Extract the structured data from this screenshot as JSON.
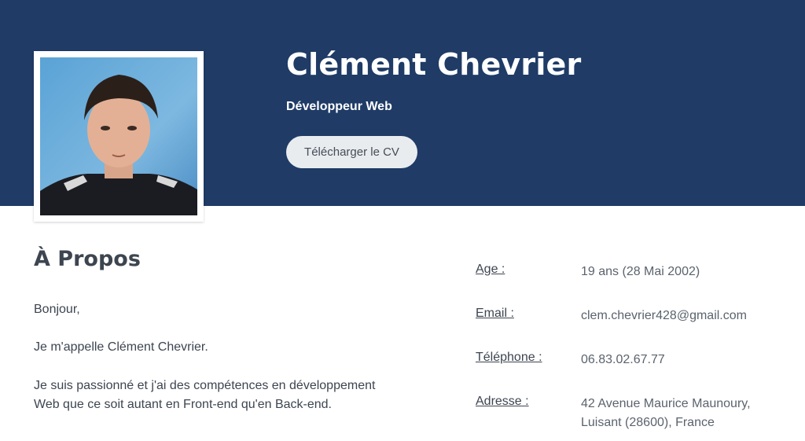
{
  "hero": {
    "name": "Clément Chevrier",
    "role": "Développeur Web",
    "cv_button": "Télécharger le CV",
    "background_color": "#1f3b66"
  },
  "about": {
    "title": "À Propos",
    "paragraphs": [
      "Bonjour,",
      "Je m'appelle Clément Chevrier.",
      "Je suis passionné et j'ai des compétences en développement Web que ce soit autant en Front-end qu'en Back-end."
    ]
  },
  "info": [
    {
      "label": "Age :",
      "value": "19 ans (28 Mai 2002)"
    },
    {
      "label": "Email :",
      "value": "clem.chevrier428@gmail.com"
    },
    {
      "label": "Téléphone :",
      "value": "06.83.02.67.77"
    },
    {
      "label": "Adresse :",
      "value": "42 Avenue Maurice Maunoury, Luisant (28600), France"
    }
  ]
}
